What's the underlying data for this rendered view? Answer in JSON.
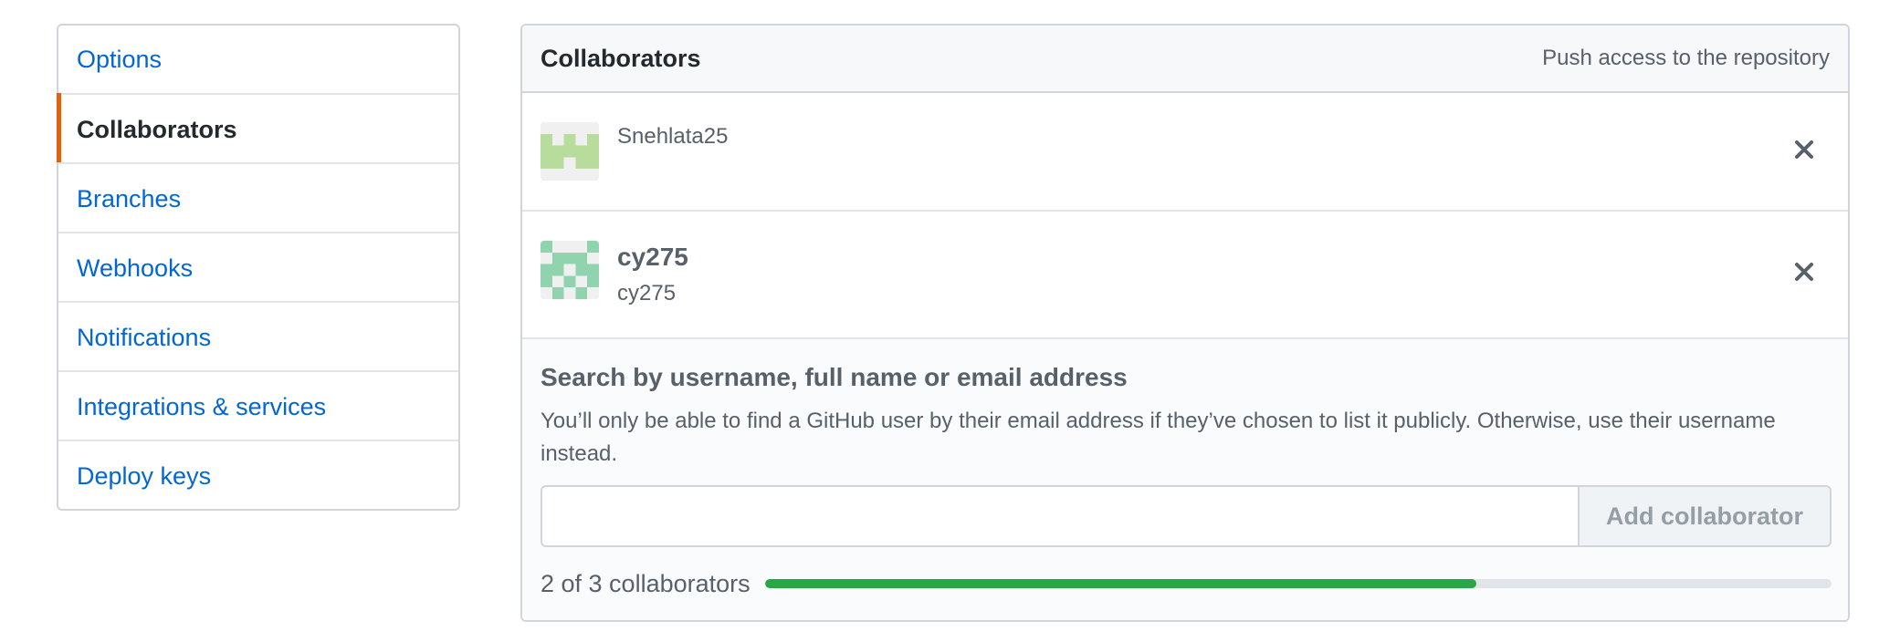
{
  "menu": {
    "items": [
      {
        "label": "Options",
        "selected": false
      },
      {
        "label": "Collaborators",
        "selected": true
      },
      {
        "label": "Branches",
        "selected": false
      },
      {
        "label": "Webhooks",
        "selected": false
      },
      {
        "label": "Notifications",
        "selected": false
      },
      {
        "label": "Integrations & services",
        "selected": false
      },
      {
        "label": "Deploy keys",
        "selected": false
      }
    ]
  },
  "collaborators": {
    "title": "Collaborators",
    "subtitle": "Push access to the repository",
    "list": [
      {
        "login": "Snehlata25",
        "name": "",
        "avatar_color": "#b7dc9c",
        "remove_icon": "close-icon"
      },
      {
        "login": "cy275",
        "name": "cy275",
        "avatar_color": "#8fd4ae",
        "remove_icon": "close-icon"
      }
    ],
    "add": {
      "heading": "Search by username, full name or email address",
      "note": "You’ll only be able to find a GitHub user by their email address if they’ve chosen to list it publicly. Otherwise, use their username instead.",
      "input_value": "",
      "input_placeholder": "",
      "button_label": "Add collaborator"
    },
    "count_text": "2 of 3 collaborators",
    "progress_fraction": 0.6667
  },
  "colors": {
    "accent_selected": "#e36209",
    "link": "#0366d6",
    "progress": "#28a745"
  }
}
